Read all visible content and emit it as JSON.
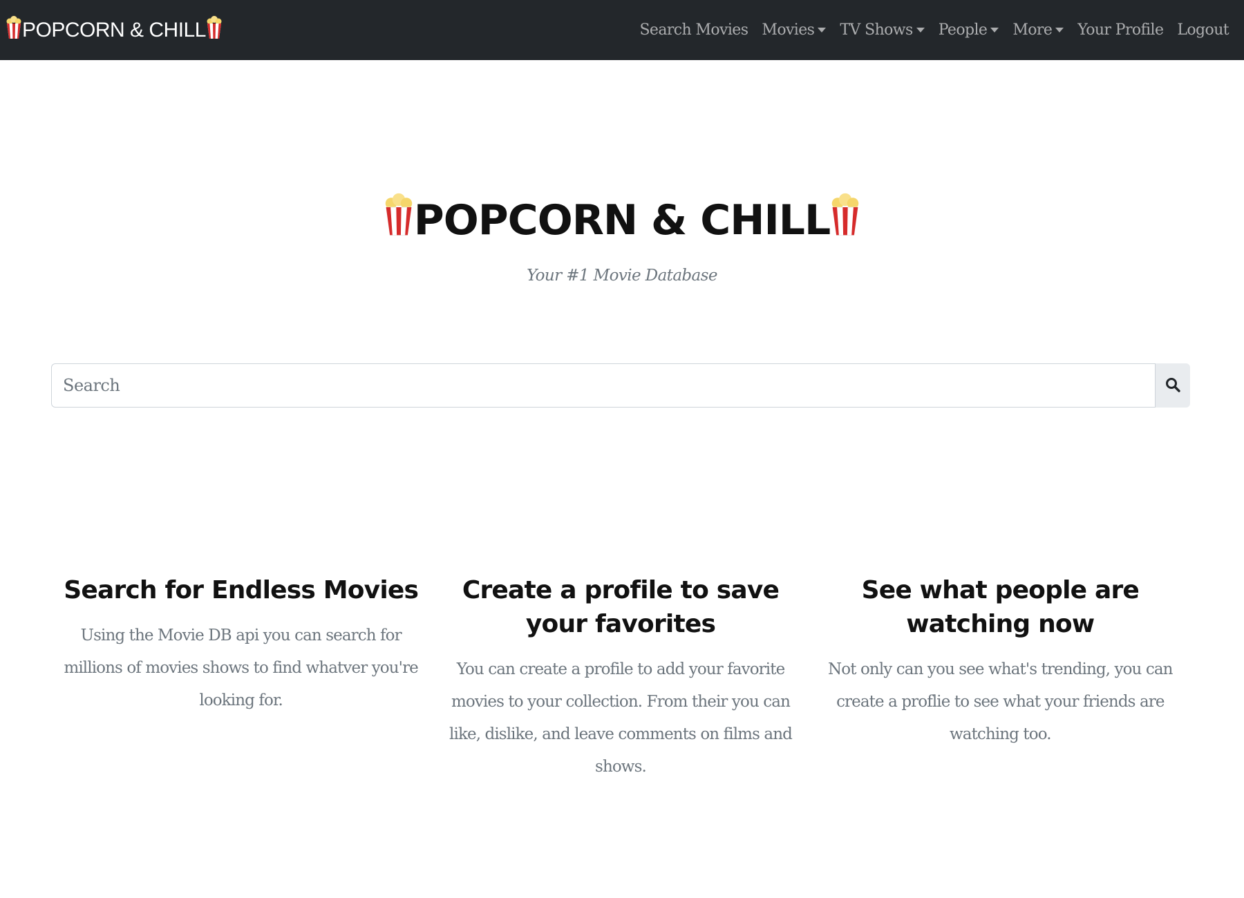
{
  "navbar": {
    "brand": "POPCORN & CHILL",
    "links": [
      {
        "label": "Search Movies",
        "dropdown": false
      },
      {
        "label": "Movies",
        "dropdown": true
      },
      {
        "label": "TV Shows",
        "dropdown": true
      },
      {
        "label": "People",
        "dropdown": true
      },
      {
        "label": "More",
        "dropdown": true
      },
      {
        "label": "Your Profile",
        "dropdown": false
      },
      {
        "label": "Logout",
        "dropdown": false
      }
    ]
  },
  "hero": {
    "title": "POPCORN & CHILL",
    "subtitle": "Your #1 Movie Database",
    "icon": "popcorn-icon"
  },
  "search": {
    "placeholder": "Search",
    "button_icon": "search-icon"
  },
  "features": [
    {
      "title": "Search for Endless Movies",
      "text": "Using the Movie DB api you can search for millions of movies shows to find whatver you're looking for."
    },
    {
      "title": "Create a profile to save your favorites",
      "text": "You can create a profile to add your favorite movies to your collection. From their you can like, dislike, and leave comments on films and shows."
    },
    {
      "title": "See what people are watching now",
      "text": "Not only can you see what's trending, you can create a proflie to see what your friends are watching too."
    }
  ],
  "colors": {
    "navbar_bg": "#23272b",
    "nav_text": "rgba(255,255,255,0.62)",
    "muted_text": "#6c757d",
    "heading_text": "#111111",
    "popcorn_red": "#d62b2b",
    "popcorn_kernel": "#f5d66b"
  }
}
